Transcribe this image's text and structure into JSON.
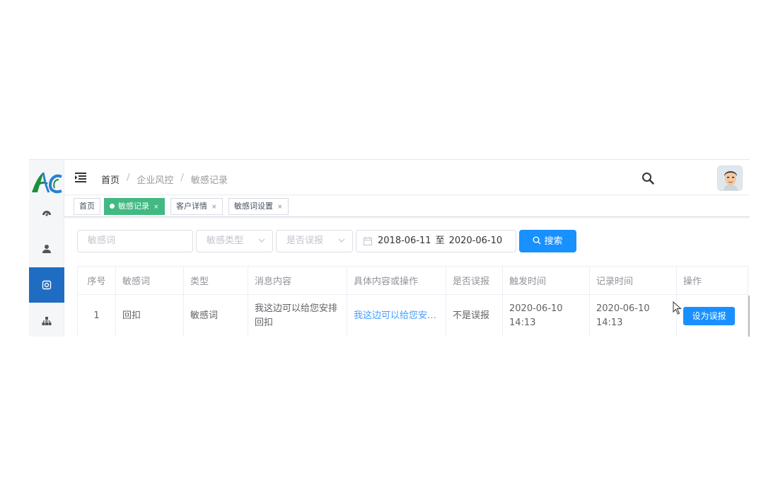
{
  "colors": {
    "sidebar_active": "#1f6dc2",
    "primary": "#1890ff",
    "tag_active": "#42b983",
    "link": "#409eff"
  },
  "sidebar": {
    "logo": "logo",
    "items": [
      {
        "icon": "dashboard-icon",
        "active": false
      },
      {
        "icon": "user-icon",
        "active": false
      },
      {
        "icon": "shield-icon",
        "active": true
      },
      {
        "icon": "org-chart-icon",
        "active": false
      }
    ]
  },
  "header": {
    "breadcrumb": [
      "首页",
      "企业风控",
      "敏感记录"
    ],
    "search_icon": "search-icon",
    "avatar": "avatar"
  },
  "tags": [
    {
      "label": "首页",
      "active": false,
      "closable": false
    },
    {
      "label": "敏感记录",
      "active": true,
      "closable": true
    },
    {
      "label": "客户详情",
      "active": false,
      "closable": true
    },
    {
      "label": "敏感词设置",
      "active": false,
      "closable": true
    }
  ],
  "tag_close": "×",
  "filters": {
    "keyword_placeholder": "敏感词",
    "type_placeholder": "敏感类型",
    "false_report_placeholder": "是否误报",
    "date_start": "2018-06-11",
    "date_to": "至",
    "date_end": "2020-06-10",
    "search_label": "搜索"
  },
  "table": {
    "columns": [
      "序号",
      "敏感词",
      "类型",
      "消息内容",
      "具体内容或操作",
      "是否误报",
      "触发时间",
      "记录时间",
      "操作"
    ],
    "rows": [
      {
        "index": "1",
        "word": "回扣",
        "type": "敏感词",
        "message": "我这边可以给您安排回扣",
        "detail": "我这边可以给您安排回扣",
        "false_report": "不是误报",
        "trigger_time": "2020-06-10 14:13",
        "record_time": "2020-06-10 14:13",
        "action": "设为误报"
      }
    ]
  }
}
